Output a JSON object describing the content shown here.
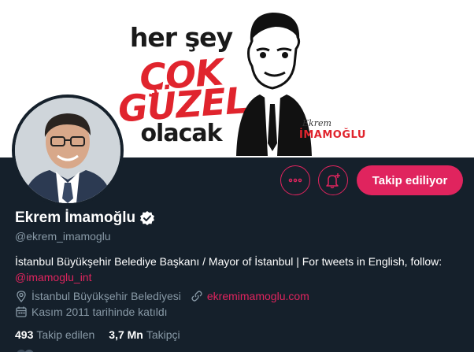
{
  "banner": {
    "slogan_line1": "her şey",
    "slogan_line2": "ÇOK",
    "slogan_line3": "GÜZEL",
    "slogan_line4": "olacak",
    "signature_script": "Ekrem",
    "signature_name": "İMAMOĞLU"
  },
  "actions": {
    "follow_label": "Takip ediliyor"
  },
  "profile": {
    "name": "Ekrem İmamoğlu",
    "handle": "@ekrem_imamoglu",
    "bio_text": "İstanbul Büyükşehir Belediye Başkanı / Mayor of İstanbul | For tweets in English, follow: ",
    "bio_link": "@imamoglu_int",
    "location": "İstanbul Büyükşehir Belediyesi",
    "website": "ekremimamoglu.com",
    "joined": "Kasım 2011 tarihinde katıldı"
  },
  "stats": {
    "following_count": "493",
    "following_label": "Takip edilen",
    "followers_count": "3,7 Mn",
    "followers_label": "Takipçi"
  },
  "colors": {
    "background": "#15202b",
    "accent": "#e0245e",
    "muted": "#8899a6",
    "banner_red": "#e0242d"
  }
}
